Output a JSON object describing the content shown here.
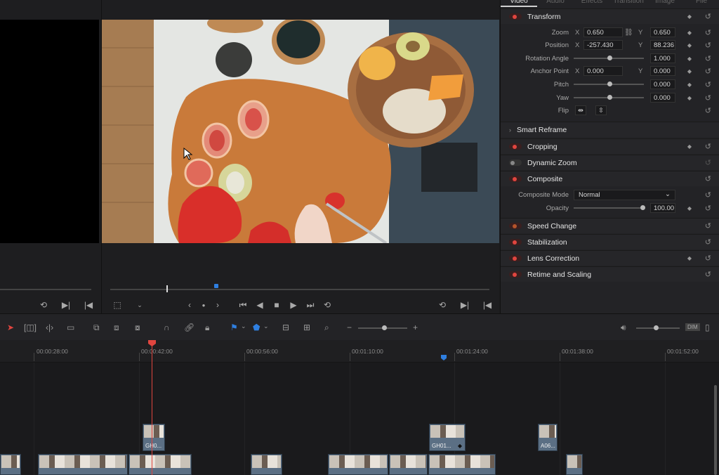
{
  "inspector": {
    "tabs": [
      "Video",
      "Audio",
      "Effects",
      "Transition",
      "Image",
      "File"
    ],
    "transform": {
      "title": "Transform",
      "zoom_label": "Zoom",
      "zoom_x": "0.650",
      "zoom_y": "0.650",
      "position_label": "Position",
      "position_x": "-257.430",
      "position_y": "88.236",
      "rotation_label": "Rotation Angle",
      "rotation": "1.000",
      "anchor_label": "Anchor Point",
      "anchor_x": "0.000",
      "anchor_y": "0.000",
      "pitch_label": "Pitch",
      "pitch": "0.000",
      "yaw_label": "Yaw",
      "yaw": "0.000",
      "flip_label": "Flip",
      "axis_x": "X",
      "axis_y": "Y"
    },
    "smart_reframe": "Smart Reframe",
    "cropping": "Cropping",
    "dynamic_zoom": "Dynamic Zoom",
    "composite": {
      "title": "Composite",
      "mode_label": "Composite Mode",
      "mode_value": "Normal",
      "opacity_label": "Opacity",
      "opacity": "100.00"
    },
    "speed_change": "Speed Change",
    "stabilization": "Stabilization",
    "lens_correction": "Lens Correction",
    "retime": "Retime and Scaling"
  },
  "toolbar": {
    "dim_label": "DIM"
  },
  "ruler": {
    "timecodes": [
      "00:00:28:00",
      "00:00:42:00",
      "00:00:56:00",
      "00:01:10:00",
      "00:01:24:00",
      "00:01:38:00",
      "00:01:52:00"
    ]
  },
  "clips": {
    "v2_a": "GH0...",
    "v2_b": "GH01...",
    "v2_c": "A06..."
  },
  "colors": {
    "accent_red": "#e0453f",
    "clip_blue": "#5b6f84",
    "marker_blue": "#2f7fe0"
  }
}
